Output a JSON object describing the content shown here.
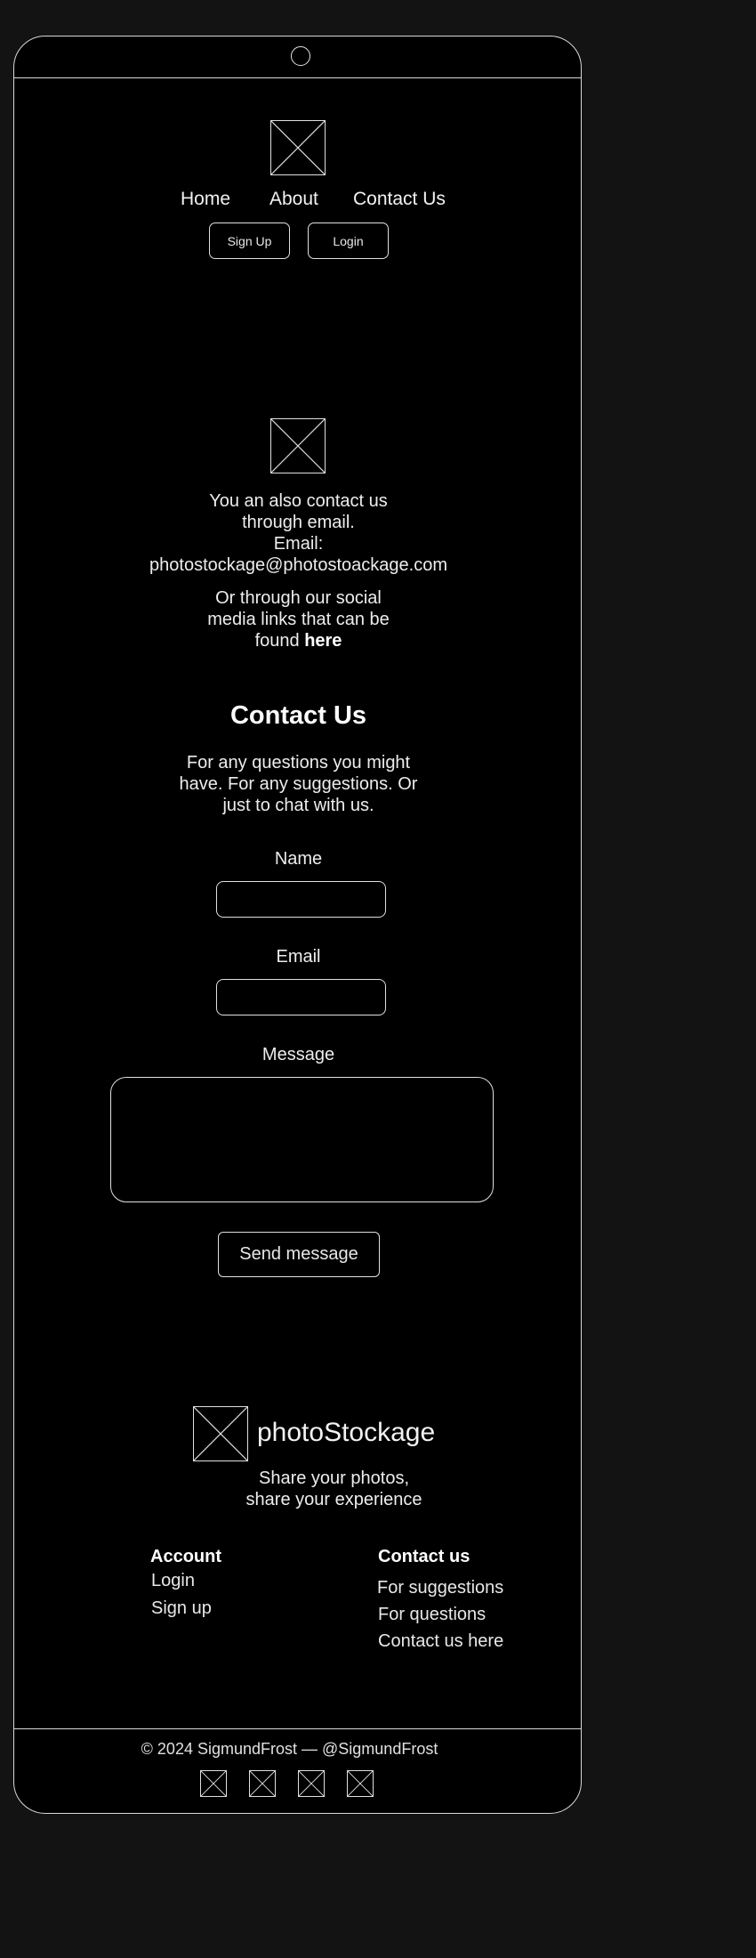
{
  "nav": {
    "items": [
      "Home",
      "About",
      "Contact Us"
    ],
    "signup_label": "Sign Up",
    "login_label": "Login"
  },
  "contact_info": {
    "line1": "You an also contact us",
    "line2": "through email.",
    "email_label": "Email:",
    "email": "photostockage@photostoackage.com",
    "social_line1": "Or through our social",
    "social_line2": "media links that can be",
    "social_found": "found",
    "social_link": "here"
  },
  "contact_form": {
    "title": "Contact Us",
    "desc_line1": "For any questions you might",
    "desc_line2": "have. For any suggestions. Or",
    "desc_line3": "just to chat with us.",
    "name_label": "Name",
    "name_value": "",
    "email_label": "Email",
    "email_value": "",
    "message_label": "Message",
    "message_value": "",
    "submit_label": "Send message"
  },
  "footer": {
    "brand": "photoStockage",
    "tagline_line1": "Share your photos,",
    "tagline_line2": "share your experience",
    "account_heading": "Account",
    "account_links": [
      "Login",
      "Sign up"
    ],
    "contact_heading": "Contact us",
    "contact_links": [
      "For suggestions",
      "For questions",
      "Contact us here"
    ],
    "copyright": "© 2024 SigmundFrost — @SigmundFrost"
  },
  "colors": {
    "page_bg": "#131313",
    "screen_bg": "#000000",
    "stroke": "#e0e0e0",
    "text": "#ffffff"
  },
  "icons": [
    "image-placeholder-icon",
    "camera-dot-icon",
    "social-placeholder-icon"
  ]
}
